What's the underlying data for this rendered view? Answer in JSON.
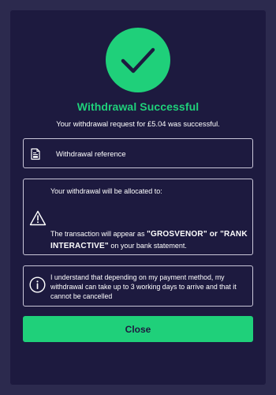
{
  "dialog": {
    "status_icon": "checkmark-icon",
    "title": "Withdrawal Successful",
    "subtitle": "Your withdrawal request for £5.04 was successful."
  },
  "reference_box": {
    "icon": "receipt-icon",
    "label": "Withdrawal reference"
  },
  "allocation_box": {
    "heading": "Your withdrawal will be allocated to:",
    "icon": "warning-icon",
    "statement_prefix": "The transaction will appear as ",
    "statement_names": "\"GROSVENOR\" or \"RANK INTERACTIVE\"",
    "statement_suffix": " on your bank statement."
  },
  "notice_box": {
    "icon": "info-icon",
    "text": "I understand that depending on my payment method, my withdrawal can take up to 3 working days to arrive and that it cannot be cancelled"
  },
  "close_button": {
    "label": "Close"
  },
  "colors": {
    "background": "#2c2a4e",
    "panel": "#1d1a3f",
    "accent": "#1fd07a",
    "text": "#ffffff"
  }
}
